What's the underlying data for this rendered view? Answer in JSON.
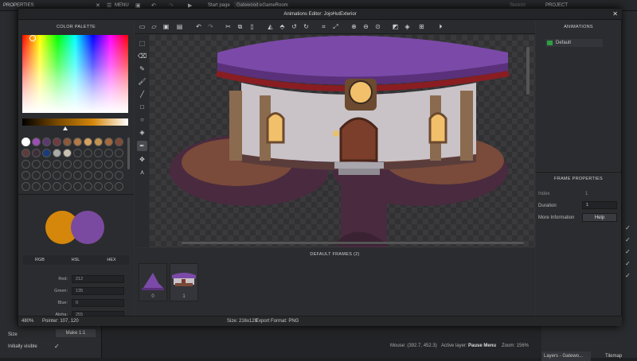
{
  "app": {
    "top": {
      "properties": "PROPERTIES",
      "menu": "MENU",
      "start_tab": "Start page",
      "tab_gatewood": "Gatewood",
      "tab_room": "eGameRoom",
      "project": "PROJECT",
      "right_tab": "Sketchr"
    },
    "bottom": {
      "mouse": "Mouse: (392.7, 452.3)",
      "active_layer_label": "Active layer:",
      "active_layer_value": "Pause Menu",
      "zoom": "Zoom: 156%",
      "layers_tab": "Layers - Gatewo...",
      "tilemap_tab": "Tilemap",
      "size_label": "Size",
      "size_btn": "Make 1:1",
      "initially_visible": "Initially visible"
    }
  },
  "editor": {
    "title": "Animations Editor: JojoHutExterior",
    "close": "✕",
    "color_palette": {
      "header": "COLOR PALETTE",
      "tabs": [
        "RGB",
        "HSL",
        "HEX"
      ],
      "fields": [
        {
          "label": "Red:",
          "value": "212"
        },
        {
          "label": "Green:",
          "value": "135"
        },
        {
          "label": "Blue:",
          "value": "0"
        },
        {
          "label": "Alpha:",
          "value": "255"
        }
      ],
      "primary_color": "#d4870b",
      "secondary_color": "#7a4aa0",
      "swatches": [
        "#ffffff",
        "#9b4fb5",
        "#5a3a6e",
        "#6e3b42",
        "#8b5a3a",
        "#b37a45",
        "#d9a15e",
        "#c4924f",
        "#a56a3c",
        "#7f4a36",
        "#5d3b3b",
        "#3e2e3a",
        "#1a3a78",
        "#aaaaaa",
        "#c9c0b0"
      ]
    },
    "animations": {
      "header": "ANIMATIONS",
      "items": [
        {
          "label": "Default",
          "color": "#2e9e44"
        }
      ]
    },
    "frame_properties": {
      "header": "FRAME PROPERTIES",
      "index_label": "Index",
      "index_value": "1",
      "duration_label": "Duration",
      "duration_value": "1",
      "more_label": "More Information",
      "help_button": "Help"
    },
    "frames": {
      "header": "DEFAULT FRAMES (2)",
      "items": [
        {
          "index": "0"
        },
        {
          "index": "1"
        }
      ]
    },
    "status": {
      "zoom": "480%",
      "pointer": "Pointer: 107, 120",
      "size": "Size: 216x120",
      "export": "Export Format: PNG"
    }
  }
}
